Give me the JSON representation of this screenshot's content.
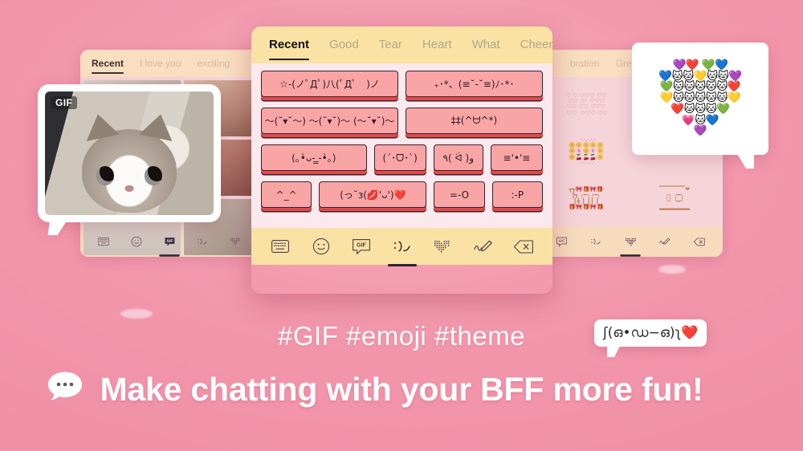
{
  "theme": {
    "background_pink": "#f295ab",
    "header_yellow": "#f9e2a3",
    "body_pink": "#fce9ed",
    "key_salmon": "#f9a5a5",
    "key_edge_red": "#e04a4a",
    "key_border": "#3a2030",
    "bubble_white": "#ffffff"
  },
  "left_panel": {
    "name": "gif-keyboard-panel",
    "tabs": [
      {
        "label": "Recent",
        "active": true
      },
      {
        "label": "I love you",
        "active": false
      },
      {
        "label": "exciting",
        "active": false
      }
    ],
    "toolbar": [
      {
        "icon": "keyboard-icon",
        "active": false
      },
      {
        "icon": "smiley-icon",
        "active": false
      },
      {
        "icon": "gif-icon",
        "active": true
      },
      {
        "icon": "kaomoji-icon",
        "active": false
      },
      {
        "icon": "emoji-art-icon",
        "active": false
      }
    ]
  },
  "gif_bubble": {
    "badge": "GIF",
    "alt": "surprised cat gif"
  },
  "center_panel": {
    "name": "kaomoji-keyboard-panel",
    "tabs": [
      {
        "label": "Recent",
        "active": true
      },
      {
        "label": "Good",
        "active": false
      },
      {
        "label": "Tear",
        "active": false
      },
      {
        "label": "Heart",
        "active": false
      },
      {
        "label": "What",
        "active": false
      },
      {
        "label": "Cheer",
        "active": false
      }
    ],
    "rows": [
      [
        {
          "text": "☆-(ノﾟДﾟ)八(ﾟДﾟ　)ノ",
          "flex": 1
        },
        {
          "text": "₊･*、(≡˘-˘≡)ﾉ･*･",
          "flex": 1
        }
      ],
      [
        {
          "text": "～(˘▾˘～) ～(˘▾˘)～ (～˘▾˘)～",
          "flex": 1
        },
        {
          "text": "‡‡(^ᗨ^*)",
          "flex": 1
        }
      ],
      [
        {
          "text": "(｡•̀ᴗ-  ̳-•̀｡)",
          "flex": 2.05
        },
        {
          "text": "(´･ᗜ･`)",
          "flex": 1
        },
        {
          "text": "٩( ᐛ )و",
          "flex": 0.95
        },
        {
          "text": "≡'•'≡",
          "flex": 1
        }
      ],
      [
        {
          "text": "^_^",
          "flex": 1
        },
        {
          "text": "(っ˘з(💋'ᴗ')❤️",
          "flex": 2.15
        },
        {
          "text": "=-O",
          "flex": 1
        },
        {
          "text": ":-P",
          "flex": 1
        }
      ]
    ],
    "toolbar": [
      {
        "icon": "keyboard-icon",
        "active": false
      },
      {
        "icon": "smiley-icon",
        "active": false
      },
      {
        "icon": "gif-icon",
        "active": false
      },
      {
        "icon": "kaomoji-icon",
        "active": true
      },
      {
        "icon": "emoji-art-icon",
        "active": false
      },
      {
        "icon": "pencil-icon",
        "active": false
      },
      {
        "icon": "backspace-icon",
        "active": false
      }
    ]
  },
  "right_panel": {
    "name": "emoji-art-keyboard-panel",
    "tabs": [
      {
        "label": "bration",
        "active": false
      },
      {
        "label": "Greeting",
        "active": false
      }
    ],
    "art_cells": [
      "♡ ♡ ♡♡♡ ♡♡\n♡♡  ♡  ♡♡♡\n♡♡ ♡♡ ♡♡♡\n ♡♡  ♡♡♡ ♡♡",
      "",
      "  ·.·.·.·.·\n🌼🌼🌼🌼🌼\n🌼🌸🌼🌸🌼\n🌼🍒🍒🍒🌼\n ·.·.·.·.·",
      "",
      "┳┳🎀🎁🎀🎁\n┣┓ ╭━╮╭━╮\n┃╋ ┃ ┃┃ ┃\n🎁🎀🎁🎀🎁",
      "▔▔▔▔▔▔❤\n╭╮ ╭━╮\n╰╯ ╰━╯\n▂▂▂▂▂▂▂"
    ],
    "toolbar": [
      {
        "icon": "gif-icon",
        "active": false
      },
      {
        "icon": "kaomoji-icon",
        "active": false
      },
      {
        "icon": "emoji-art-icon",
        "active": true
      },
      {
        "icon": "pencil-icon",
        "active": false
      },
      {
        "icon": "backspace-icon",
        "active": false
      }
    ]
  },
  "heart_bubble": {
    "name": "emoji-heart-art",
    "lines": [
      "💜❤️ 💚💙",
      "💙🐱🐱💛🐱🐱💜",
      "💚🐱🐱🐱🐱🐱❤️",
      "💛🐱🐱🐱🐱🐱💛",
      "❤️🐱🐱🐱💚",
      "💗🐱💙",
      "💜"
    ]
  },
  "mini_kao": {
    "text": "ʃ(ഒ•ഡ−ഒ)ʅ❤️"
  },
  "tagline": {
    "sub": "#GIF #emoji #theme",
    "main": "Make chatting with your BFF more fun!",
    "icon": "chat-bubble-icon"
  }
}
